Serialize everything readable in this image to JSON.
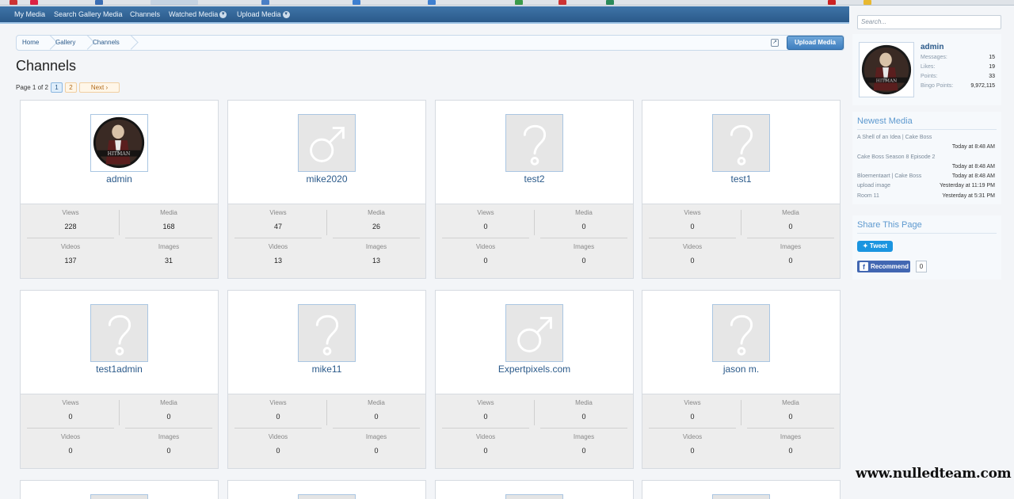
{
  "nav": {
    "items": [
      {
        "label": "My Media",
        "dropdown": false
      },
      {
        "label": "Search Gallery Media",
        "dropdown": false
      },
      {
        "label": "Channels",
        "dropdown": false
      },
      {
        "label": "Watched Media",
        "dropdown": true
      },
      {
        "label": "Upload Media",
        "dropdown": true
      }
    ]
  },
  "breadcrumb": [
    "Home",
    "Gallery",
    "Channels"
  ],
  "upload_button": "Upload Media",
  "page_title": "Channels",
  "pagination": {
    "label": "Page 1 of 2",
    "pages": [
      "1",
      "2"
    ],
    "current": "1",
    "next": "Next ›"
  },
  "stat_labels": {
    "views": "Views",
    "media": "Media",
    "videos": "Videos",
    "images": "Images"
  },
  "channels": [
    {
      "name": "admin",
      "avatar": "hitman-avatar",
      "views": "228",
      "media": "168",
      "videos": "137",
      "images": "31"
    },
    {
      "name": "mike2020",
      "avatar": "male-icon",
      "views": "47",
      "media": "26",
      "videos": "13",
      "images": "13"
    },
    {
      "name": "test2",
      "avatar": "unknown-icon",
      "views": "0",
      "media": "0",
      "videos": "0",
      "images": "0"
    },
    {
      "name": "test1",
      "avatar": "unknown-icon",
      "views": "0",
      "media": "0",
      "videos": "0",
      "images": "0"
    },
    {
      "name": "test1admin",
      "avatar": "unknown-icon",
      "views": "0",
      "media": "0",
      "videos": "0",
      "images": "0"
    },
    {
      "name": "mike11",
      "avatar": "unknown-icon",
      "views": "0",
      "media": "0",
      "videos": "0",
      "images": "0"
    },
    {
      "name": "Expertpixels.com",
      "avatar": "male-icon",
      "views": "0",
      "media": "0",
      "videos": "0",
      "images": "0"
    },
    {
      "name": "jason m.",
      "avatar": "unknown-icon",
      "views": "0",
      "media": "0",
      "videos": "0",
      "images": "0"
    }
  ],
  "sidebar": {
    "search_placeholder": "Search...",
    "visitor": {
      "username": "admin",
      "stats": [
        {
          "label": "Messages:",
          "value": "15"
        },
        {
          "label": "Likes:",
          "value": "19"
        },
        {
          "label": "Points:",
          "value": "33"
        },
        {
          "label": "Bingo Points:",
          "value": "9,972,115"
        }
      ]
    },
    "newest_media": {
      "title": "Newest Media",
      "items": [
        {
          "title": "A Shell of an Idea | Cake Boss",
          "time": "Today at 8:48 AM"
        },
        {
          "title": "Cake Boss Season 8 Episode 2",
          "time": "Today at 8:48 AM"
        },
        {
          "title": "Bloementaart | Cake Boss",
          "time": "Today at 8:48 AM"
        },
        {
          "title": "upload image",
          "time": "Yesterday at 11:19 PM"
        },
        {
          "title": "Room 11",
          "time": "Yesterday at 5:31 PM"
        }
      ]
    },
    "share": {
      "title": "Share This Page",
      "tweet": "Tweet",
      "recommend": "Recommend",
      "recommend_count": "0"
    }
  },
  "watermark": "www.nulledteam.com",
  "colors": {
    "nav": "#2b5a8a",
    "link": "#2b5a8a",
    "sidebar_heading": "#5d99cf"
  }
}
